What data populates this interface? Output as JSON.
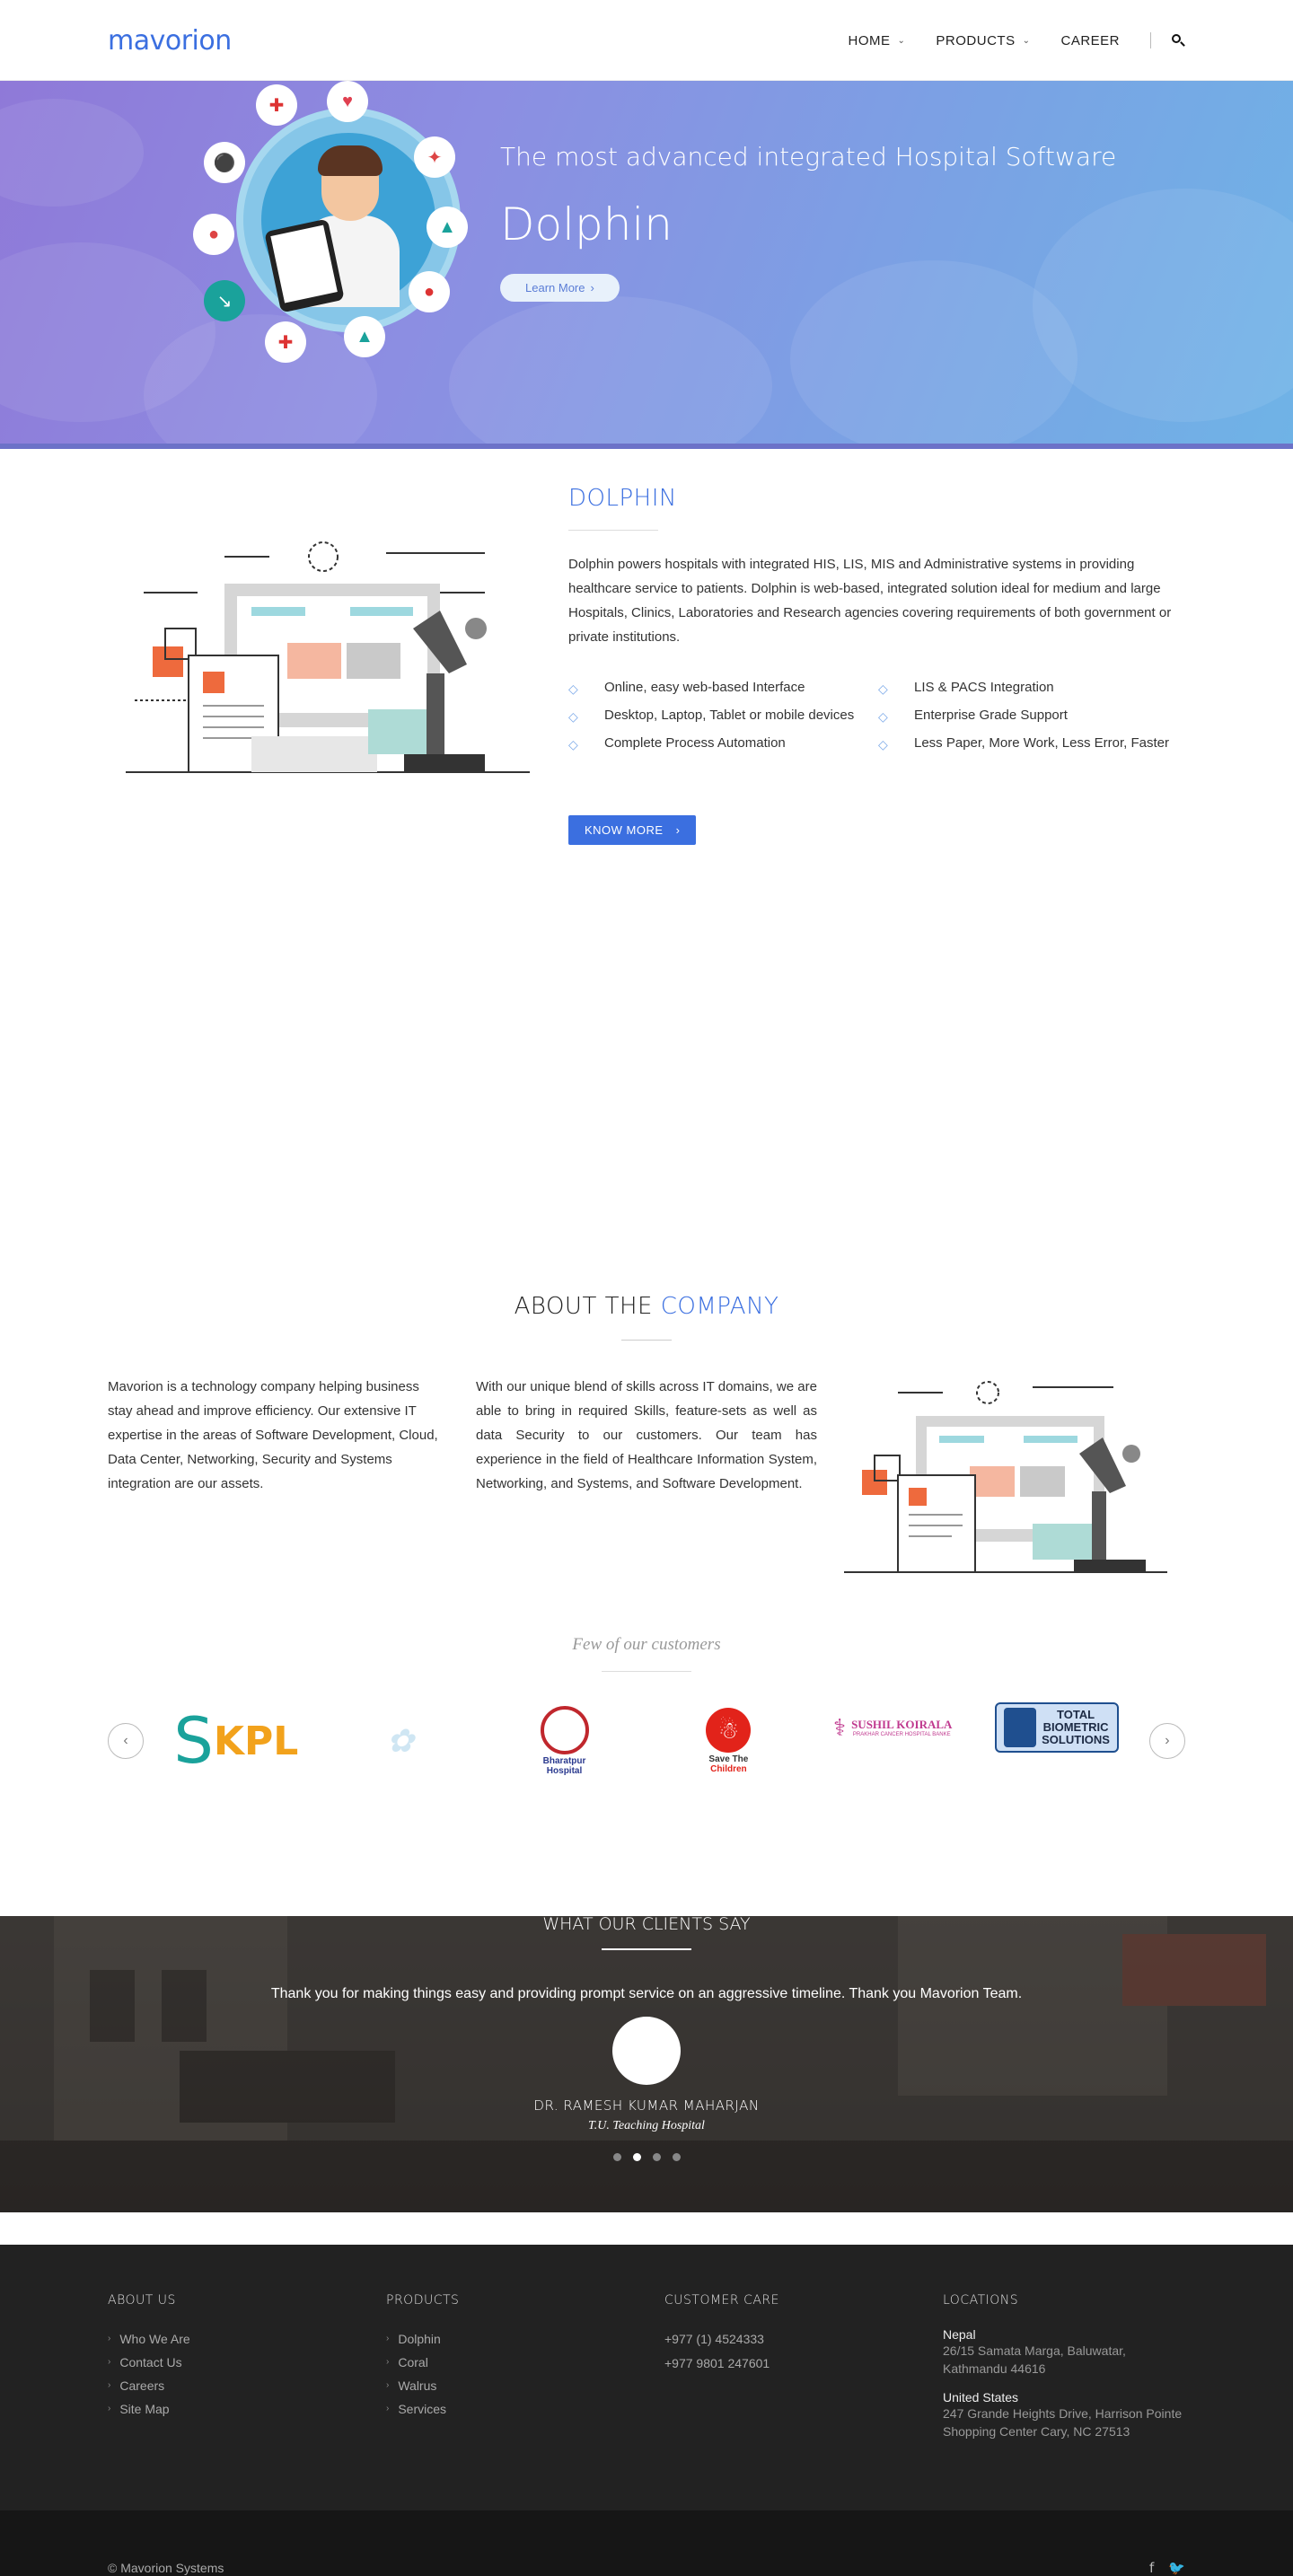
{
  "header": {
    "logo": "mavorion",
    "nav": [
      {
        "label": "HOME",
        "has_dropdown": true
      },
      {
        "label": "PRODUCTS",
        "has_dropdown": true
      },
      {
        "label": "CAREER",
        "has_dropdown": false
      }
    ],
    "search_icon": "search-icon"
  },
  "hero": {
    "subtitle": "The most advanced integrated Hospital Software",
    "title": "Dolphin",
    "button": "Learn More"
  },
  "dolphin": {
    "title": "DOLPHIN",
    "description": "Dolphin powers hospitals with integrated HIS, LIS, MIS and Administrative systems in providing healthcare service to patients. Dolphin is web-based, integrated solution ideal for medium and large Hospitals, Clinics, Laboratories and Research agencies covering requirements of both government or private institutions.",
    "features_left": [
      "Online, easy web-based Interface",
      "Desktop, Laptop, Tablet or mobile devices",
      "Complete Process Automation"
    ],
    "features_right": [
      "LIS & PACS Integration",
      "Enterprise Grade Support",
      "Less Paper, More Work, Less Error, Faster"
    ],
    "button": "KNOW MORE"
  },
  "about": {
    "title_a": "ABOUT THE",
    "title_b": "COMPANY",
    "col1": "Mavorion is a technology company helping business stay ahead and improve efficiency. Our extensive IT expertise in the areas of Software Development, Cloud, Data Center, Networking, Security and Systems integration are our assets.",
    "col2": "With our unique blend of skills across IT domains, we are able to bring in required Skills, feature-sets as well as data Security to our customers. Our team has experience in the field of Healthcare Information System, Networking, and Systems, and Software Development.",
    "customers_title": "Few of our customers",
    "logos": {
      "kpl": "KPL",
      "bharatpur_a": "Bharatpur",
      "bharatpur_b": "Hospital",
      "save_a": "Save The",
      "save_b": "Children",
      "sushil_a": "SUSHIL KOIRALA",
      "sushil_b": "PRAKHAR CANCER HOSPITAL BANKE",
      "tbs_a": "TOTAL",
      "tbs_b": "BIOMETRIC",
      "tbs_c": "SOLUTIONS"
    }
  },
  "testimonials": {
    "title": "WHAT OUR CLIENTS SAY",
    "quote": "Thank you for making things easy and providing prompt service on an aggressive timeline. Thank you Mavorion Team.",
    "name": "DR. RAMESH KUMAR MAHARJAN",
    "org": "T.U. Teaching Hospital",
    "dots": 4,
    "active_dot": 2
  },
  "footer": {
    "about": {
      "heading": "ABOUT US",
      "links": [
        "Who We Are",
        "Contact Us",
        "Careers",
        "Site Map"
      ]
    },
    "products": {
      "heading": "PRODUCTS",
      "links": [
        "Dolphin",
        "Coral",
        "Walrus",
        "Services"
      ]
    },
    "care": {
      "heading": "CUSTOMER CARE",
      "phones": [
        "+977 (1) 4524333",
        "+977 9801 247601"
      ]
    },
    "locations": {
      "heading": "LOCATIONS",
      "nepal_name": "Nepal",
      "nepal_addr1": "26/15 Samata Marga, Baluwatar,",
      "nepal_addr2": "Kathmandu 44616",
      "us_name": "United States",
      "us_addr1": "247 Grande Heights Drive, Harrison Pointe",
      "us_addr2": "Shopping Center Cary, NC 27513"
    },
    "copyright": "© Mavorion Systems",
    "social": [
      "f",
      "t"
    ]
  },
  "colors": {
    "accent": "#3b6fe0",
    "footer": "#222222",
    "hero_start": "#8f79d8",
    "hero_end": "#6fb3e6"
  }
}
